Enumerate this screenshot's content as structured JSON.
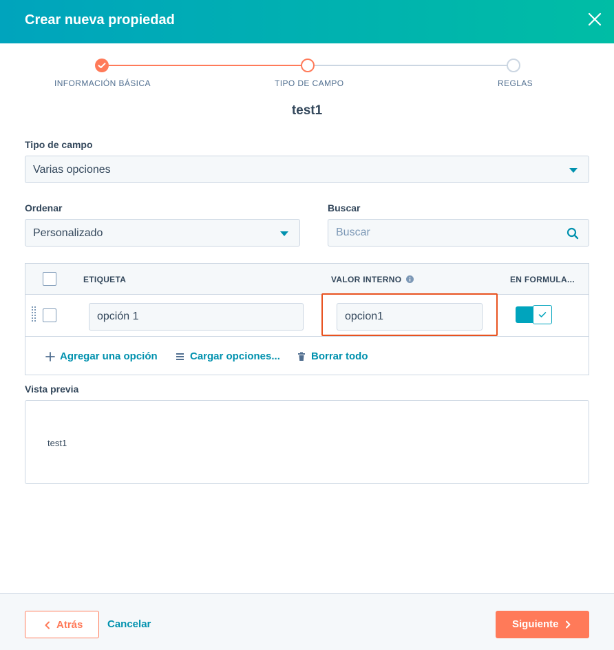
{
  "header": {
    "title": "Crear nueva propiedad",
    "close_icon": "close-icon"
  },
  "stepper": {
    "steps": [
      {
        "label": "INFORMACIÓN BÁSICA",
        "state": "completed"
      },
      {
        "label": "TIPO DE CAMPO",
        "state": "current"
      },
      {
        "label": "REGLAS",
        "state": "upcoming"
      }
    ]
  },
  "form": {
    "title": "test1",
    "field_type": {
      "label": "Tipo de campo",
      "value": "Varias opciones"
    },
    "order": {
      "label": "Ordenar",
      "value": "Personalizado"
    },
    "search": {
      "label": "Buscar",
      "placeholder": "Buscar"
    }
  },
  "table": {
    "headers": {
      "label": "ETIQUETA",
      "internal_value": "VALOR INTERNO",
      "in_forms": "EN FORMULA..."
    },
    "rows": [
      {
        "label": "opción 1",
        "internal_value": "opcion1",
        "in_forms": true
      }
    ],
    "actions": {
      "add": "Agregar una opción",
      "load": "Cargar opciones...",
      "clear": "Borrar todo"
    }
  },
  "preview": {
    "label": "Vista previa",
    "text": "test1"
  },
  "footer": {
    "back": "Atrás",
    "cancel": "Cancelar",
    "next": "Siguiente"
  },
  "colors": {
    "accent": "#00a4bd",
    "link": "#0091ae",
    "primary_button": "#ff7a59",
    "highlight_box": "#e8521f"
  }
}
